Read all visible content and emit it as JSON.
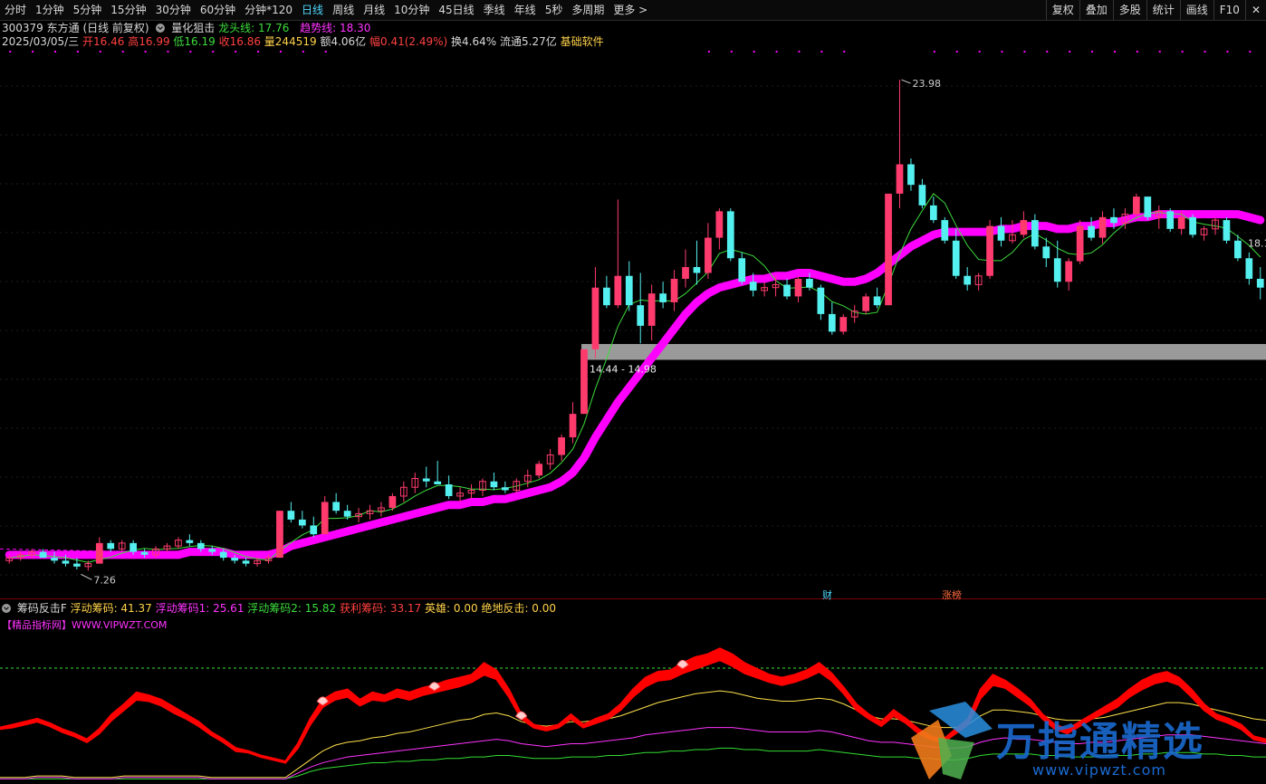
{
  "toolbar": {
    "items": [
      "分时",
      "1分钟",
      "5分钟",
      "15分钟",
      "30分钟",
      "60分钟",
      "分钟*120",
      "日线",
      "周线",
      "月线",
      "10分钟",
      "45日线",
      "季线",
      "年线",
      "5秒",
      "多周期",
      "更多 >"
    ],
    "active_index": 7,
    "right_buttons": [
      "复权",
      "叠加",
      "多股",
      "统计",
      "画线",
      "F10",
      "✕"
    ]
  },
  "header": {
    "code_name": "300379 东方通 (日线 前复权)",
    "indicator_name": "量化狙击",
    "dragon_label": "龙头线: 17.76",
    "trend_label": "趋势线: 18.30"
  },
  "quote": {
    "date": "2025/03/05/三",
    "open": "开16.46",
    "high": "高16.99",
    "low": "低16.19",
    "close": "收16.86",
    "volume": "量244519",
    "amount": "额4.06亿",
    "change": "幅0.41(2.49%)",
    "turnover": "换4.64%",
    "float": "流通5.27亿",
    "tag": "基础软件"
  },
  "labels": {
    "high_label": "23.98",
    "low_label": "7.26",
    "zone_label": "14.44 - 14.98",
    "right_price": "18.1",
    "cai": "财",
    "zhangbang": "涨榜"
  },
  "indicator": {
    "name": "筹码反击F",
    "float_label": "浮动筹码: 41.37",
    "float1_label": "浮动筹码1: 25.61",
    "float2_label": "浮动筹码2: 15.82",
    "profit_label": "获利筹码: 33.17",
    "hero_label": "英雄: 0.00",
    "rebound_label": "绝地反击: 0.00",
    "source": "【精品指标网】WWW.VIPWZT.COM"
  },
  "watermark": {
    "text": "万指通精选",
    "url": "www.vipwzt.com"
  },
  "colors": {
    "up": "#ff3b6e",
    "down": "#54f0f0",
    "trend": "#ff00ff",
    "ma": "#3ddc3d",
    "zone": "#9a9a9a",
    "ind_red": "#ff0000",
    "ind_yellow": "#ffe14a",
    "ind_magenta": "#ff33ff",
    "ind_green": "#33dd33"
  },
  "chart_data": {
    "type": "candlestick",
    "ylim": [
      6.5,
      25
    ],
    "candles": [
      [
        7.6,
        7.8,
        7.5,
        7.7
      ],
      [
        7.7,
        7.9,
        7.6,
        7.8
      ],
      [
        7.8,
        8.0,
        7.7,
        7.9
      ],
      [
        7.9,
        8.0,
        7.7,
        7.7
      ],
      [
        7.7,
        7.9,
        7.5,
        7.6
      ],
      [
        7.6,
        7.8,
        7.4,
        7.5
      ],
      [
        7.5,
        7.7,
        7.3,
        7.4
      ],
      [
        7.4,
        7.6,
        7.26,
        7.5
      ],
      [
        7.5,
        8.4,
        7.5,
        8.2
      ],
      [
        8.2,
        8.3,
        7.9,
        8.0
      ],
      [
        8.0,
        8.3,
        7.9,
        8.2
      ],
      [
        8.2,
        8.3,
        7.8,
        7.9
      ],
      [
        7.9,
        8.0,
        7.7,
        7.8
      ],
      [
        7.8,
        8.1,
        7.7,
        8.0
      ],
      [
        8.0,
        8.2,
        7.9,
        8.1
      ],
      [
        8.1,
        8.4,
        8.0,
        8.3
      ],
      [
        8.3,
        8.5,
        8.1,
        8.2
      ],
      [
        8.2,
        8.3,
        7.9,
        8.0
      ],
      [
        8.0,
        8.1,
        7.8,
        7.9
      ],
      [
        7.9,
        8.0,
        7.6,
        7.7
      ],
      [
        7.7,
        7.8,
        7.5,
        7.6
      ],
      [
        7.6,
        7.7,
        7.4,
        7.5
      ],
      [
        7.5,
        7.7,
        7.4,
        7.6
      ],
      [
        7.6,
        7.8,
        7.5,
        7.7
      ],
      [
        7.7,
        9.3,
        7.7,
        9.3
      ],
      [
        9.3,
        9.6,
        8.9,
        9.0
      ],
      [
        9.0,
        9.3,
        8.7,
        8.8
      ],
      [
        8.8,
        9.1,
        8.4,
        8.5
      ],
      [
        8.5,
        9.8,
        8.5,
        9.6
      ],
      [
        9.6,
        9.9,
        9.2,
        9.3
      ],
      [
        9.3,
        9.5,
        9.0,
        9.1
      ],
      [
        9.1,
        9.4,
        8.9,
        9.2
      ],
      [
        9.2,
        9.5,
        9.0,
        9.3
      ],
      [
        9.3,
        9.6,
        9.1,
        9.4
      ],
      [
        9.4,
        9.9,
        9.3,
        9.8
      ],
      [
        9.8,
        10.3,
        9.6,
        10.1
      ],
      [
        10.1,
        10.6,
        9.9,
        10.4
      ],
      [
        10.4,
        10.8,
        10.1,
        10.3
      ],
      [
        10.3,
        11.0,
        10.2,
        10.2
      ],
      [
        10.2,
        10.5,
        9.7,
        9.8
      ],
      [
        9.8,
        10.1,
        9.6,
        9.9
      ],
      [
        9.9,
        10.2,
        9.7,
        10.0
      ],
      [
        10.0,
        10.4,
        9.8,
        10.3
      ],
      [
        10.3,
        10.6,
        10.0,
        10.1
      ],
      [
        10.1,
        10.3,
        9.9,
        10.0
      ],
      [
        10.0,
        10.4,
        9.9,
        10.3
      ],
      [
        10.3,
        10.7,
        10.1,
        10.5
      ],
      [
        10.5,
        11.0,
        10.4,
        10.9
      ],
      [
        10.9,
        11.4,
        10.7,
        11.2
      ],
      [
        11.2,
        11.9,
        11.0,
        11.8
      ],
      [
        11.8,
        13.0,
        11.6,
        12.6
      ],
      [
        12.6,
        14.8,
        12.6,
        14.8
      ],
      [
        14.8,
        17.6,
        14.5,
        16.9
      ],
      [
        16.9,
        17.3,
        16.2,
        16.3
      ],
      [
        16.3,
        19.9,
        16.2,
        17.3
      ],
      [
        17.3,
        17.8,
        16.1,
        16.3
      ],
      [
        16.3,
        17.4,
        15.0,
        15.6
      ],
      [
        15.6,
        17.0,
        15.1,
        16.7
      ],
      [
        16.7,
        17.1,
        16.2,
        16.4
      ],
      [
        16.4,
        17.5,
        16.1,
        17.2
      ],
      [
        17.2,
        18.2,
        16.9,
        17.6
      ],
      [
        17.6,
        18.5,
        17.0,
        17.4
      ],
      [
        17.4,
        19.1,
        17.2,
        18.6
      ],
      [
        18.6,
        19.6,
        18.2,
        19.5
      ],
      [
        19.5,
        19.6,
        17.8,
        17.9
      ],
      [
        17.9,
        18.1,
        17.0,
        17.1
      ],
      [
        17.1,
        17.4,
        16.6,
        16.8
      ],
      [
        16.8,
        17.1,
        16.6,
        16.9
      ],
      [
        16.9,
        17.3,
        16.6,
        17.0
      ],
      [
        17.0,
        17.2,
        16.5,
        16.6
      ],
      [
        16.6,
        17.3,
        16.4,
        17.2
      ],
      [
        17.2,
        17.4,
        16.8,
        16.9
      ],
      [
        16.9,
        17.0,
        15.8,
        16.0
      ],
      [
        16.0,
        16.4,
        15.3,
        15.4
      ],
      [
        15.4,
        16.0,
        15.3,
        15.9
      ],
      [
        15.9,
        16.3,
        15.7,
        16.1
      ],
      [
        16.1,
        16.7,
        16.0,
        16.6
      ],
      [
        16.6,
        16.9,
        16.2,
        16.3
      ],
      [
        16.3,
        20.1,
        16.3,
        20.1
      ],
      [
        20.1,
        23.98,
        19.6,
        21.1
      ],
      [
        21.1,
        21.3,
        20.2,
        20.4
      ],
      [
        20.4,
        20.6,
        19.6,
        19.7
      ],
      [
        19.7,
        20.0,
        19.1,
        19.2
      ],
      [
        19.2,
        19.3,
        18.4,
        18.5
      ],
      [
        18.5,
        18.9,
        17.2,
        17.3
      ],
      [
        17.3,
        17.6,
        16.8,
        17.0
      ],
      [
        17.0,
        17.4,
        16.8,
        17.3
      ],
      [
        17.3,
        19.2,
        17.2,
        19.0
      ],
      [
        19.0,
        19.3,
        18.3,
        18.5
      ],
      [
        18.5,
        19.2,
        18.4,
        18.7
      ],
      [
        18.7,
        19.5,
        18.6,
        19.2
      ],
      [
        19.2,
        19.4,
        18.2,
        18.3
      ],
      [
        18.3,
        18.6,
        17.6,
        17.9
      ],
      [
        17.9,
        18.5,
        16.9,
        17.1
      ],
      [
        17.1,
        17.9,
        16.8,
        17.8
      ],
      [
        17.8,
        19.2,
        17.7,
        19.0
      ],
      [
        19.0,
        19.3,
        18.5,
        18.6
      ],
      [
        18.6,
        19.5,
        18.4,
        19.3
      ],
      [
        19.3,
        19.6,
        18.9,
        19.1
      ],
      [
        19.1,
        19.6,
        18.9,
        19.4
      ],
      [
        19.4,
        20.1,
        19.3,
        20.0
      ],
      [
        20.0,
        20.0,
        19.2,
        19.3
      ],
      [
        19.3,
        19.7,
        18.9,
        19.5
      ],
      [
        19.5,
        19.6,
        18.8,
        18.9
      ],
      [
        18.9,
        19.5,
        18.7,
        19.3
      ],
      [
        19.3,
        19.4,
        18.6,
        18.7
      ],
      [
        18.7,
        19.0,
        18.5,
        18.9
      ],
      [
        18.9,
        19.3,
        18.7,
        19.2
      ],
      [
        19.2,
        19.3,
        18.4,
        18.5
      ],
      [
        18.5,
        18.7,
        17.8,
        17.9
      ],
      [
        17.9,
        18.1,
        17.0,
        17.2
      ],
      [
        17.2,
        17.6,
        16.5,
        16.9
      ]
    ],
    "trend_line": [
      7.8,
      7.8,
      7.8,
      7.8,
      7.8,
      7.8,
      7.8,
      7.8,
      7.8,
      7.8,
      7.8,
      7.8,
      7.8,
      7.8,
      7.8,
      7.8,
      7.9,
      7.9,
      7.9,
      7.9,
      7.8,
      7.8,
      7.8,
      7.8,
      7.9,
      8.1,
      8.2,
      8.3,
      8.4,
      8.5,
      8.6,
      8.7,
      8.8,
      8.9,
      9.0,
      9.1,
      9.2,
      9.3,
      9.4,
      9.5,
      9.5,
      9.6,
      9.6,
      9.7,
      9.7,
      9.8,
      9.9,
      10.0,
      10.1,
      10.3,
      10.6,
      11.1,
      11.8,
      12.4,
      13.0,
      13.5,
      14.0,
      14.5,
      15.0,
      15.5,
      16.0,
      16.4,
      16.7,
      16.9,
      17.0,
      17.1,
      17.2,
      17.2,
      17.3,
      17.3,
      17.4,
      17.4,
      17.3,
      17.2,
      17.1,
      17.1,
      17.2,
      17.4,
      17.7,
      18.0,
      18.3,
      18.5,
      18.7,
      18.8,
      18.8,
      18.8,
      18.8,
      18.8,
      18.9,
      18.9,
      19.0,
      19.0,
      19.0,
      18.9,
      18.9,
      19.0,
      19.0,
      19.1,
      19.1,
      19.2,
      19.3,
      19.3,
      19.4,
      19.4,
      19.4,
      19.4,
      19.4,
      19.4,
      19.4,
      19.4,
      19.3,
      19.2
    ],
    "indicator": {
      "ylim": [
        0,
        100
      ],
      "red_top": [
        36,
        38,
        40,
        42,
        39,
        35,
        32,
        28,
        35,
        45,
        52,
        60,
        58,
        55,
        50,
        45,
        40,
        33,
        28,
        22,
        20,
        17,
        15,
        13,
        25,
        42,
        55,
        60,
        62,
        55,
        60,
        58,
        62,
        60,
        63,
        65,
        68,
        70,
        72,
        80,
        75,
        62,
        45,
        38,
        36,
        38,
        45,
        38,
        42,
        45,
        52,
        62,
        70,
        74,
        75,
        80,
        84,
        86,
        90,
        86,
        80,
        76,
        72,
        70,
        72,
        75,
        80,
        73,
        63,
        52,
        45,
        40,
        48,
        42,
        35,
        30,
        28,
        35,
        42,
        62,
        72,
        68,
        62,
        55,
        45,
        38,
        35,
        40,
        45,
        50,
        55,
        62,
        68,
        72,
        74,
        70,
        62,
        52,
        45,
        42,
        38,
        30,
        28
      ],
      "red_bot": [
        35,
        36,
        38,
        40,
        37,
        33,
        30,
        26,
        32,
        41,
        48,
        55,
        54,
        51,
        46,
        42,
        37,
        31,
        26,
        20,
        19,
        16,
        14,
        12,
        22,
        38,
        50,
        55,
        57,
        51,
        55,
        54,
        57,
        55,
        58,
        60,
        62,
        64,
        67,
        72,
        69,
        57,
        42,
        36,
        34,
        36,
        42,
        36,
        39,
        42,
        48,
        57,
        64,
        68,
        69,
        73,
        76,
        79,
        82,
        78,
        73,
        70,
        67,
        65,
        67,
        70,
        74,
        68,
        59,
        48,
        42,
        37,
        44,
        39,
        32,
        28,
        26,
        32,
        38,
        56,
        65,
        63,
        57,
        51,
        42,
        35,
        32,
        37,
        42,
        46,
        50,
        57,
        62,
        66,
        68,
        65,
        57,
        48,
        42,
        39,
        35,
        28,
        26
      ],
      "yellow": [
        2,
        2,
        2,
        3,
        3,
        3,
        2,
        2,
        2,
        2,
        3,
        3,
        3,
        3,
        3,
        3,
        3,
        2,
        2,
        2,
        2,
        2,
        2,
        2,
        8,
        14,
        20,
        24,
        26,
        27,
        29,
        30,
        32,
        33,
        35,
        37,
        39,
        41,
        42,
        45,
        46,
        44,
        40,
        38,
        37,
        38,
        40,
        40,
        41,
        42,
        44,
        47,
        50,
        53,
        55,
        57,
        59,
        60,
        61,
        60,
        58,
        56,
        55,
        54,
        54,
        55,
        56,
        55,
        52,
        48,
        44,
        42,
        42,
        41,
        39,
        37,
        36,
        36,
        38,
        44,
        48,
        48,
        47,
        46,
        44,
        42,
        41,
        41,
        42,
        43,
        45,
        47,
        49,
        51,
        53,
        53,
        52,
        50,
        48,
        46,
        44,
        42,
        41
      ],
      "magenta": [
        1,
        1,
        1,
        2,
        2,
        2,
        1,
        1,
        1,
        1,
        2,
        2,
        2,
        2,
        2,
        2,
        2,
        1,
        1,
        1,
        1,
        1,
        1,
        1,
        5,
        9,
        12,
        14,
        16,
        17,
        18,
        19,
        20,
        21,
        22,
        23,
        24,
        25,
        26,
        27,
        28,
        27,
        25,
        24,
        23,
        24,
        25,
        25,
        26,
        27,
        28,
        29,
        31,
        32,
        33,
        34,
        35,
        36,
        36,
        36,
        35,
        34,
        33,
        33,
        33,
        33,
        34,
        33,
        31,
        29,
        27,
        26,
        26,
        25,
        24,
        23,
        22,
        22,
        23,
        26,
        28,
        29,
        28,
        28,
        27,
        26,
        25,
        25,
        26,
        26,
        27,
        28,
        29,
        30,
        31,
        31,
        31,
        30,
        29,
        28,
        27,
        26,
        25
      ],
      "green": [
        1,
        1,
        1,
        1,
        1,
        1,
        1,
        1,
        1,
        1,
        1,
        1,
        1,
        1,
        1,
        1,
        1,
        1,
        1,
        1,
        1,
        1,
        1,
        1,
        3,
        6,
        8,
        9,
        10,
        11,
        12,
        12,
        13,
        13,
        14,
        14,
        15,
        15,
        16,
        16,
        17,
        17,
        16,
        15,
        15,
        15,
        16,
        16,
        16,
        17,
        17,
        18,
        19,
        19,
        20,
        20,
        21,
        21,
        22,
        22,
        21,
        21,
        20,
        20,
        20,
        20,
        21,
        20,
        19,
        18,
        17,
        16,
        16,
        16,
        15,
        15,
        14,
        14,
        15,
        17,
        18,
        18,
        18,
        18,
        17,
        17,
        16,
        16,
        16,
        17,
        17,
        17,
        18,
        18,
        19,
        19,
        19,
        18,
        18,
        17,
        17,
        16,
        16
      ]
    }
  }
}
